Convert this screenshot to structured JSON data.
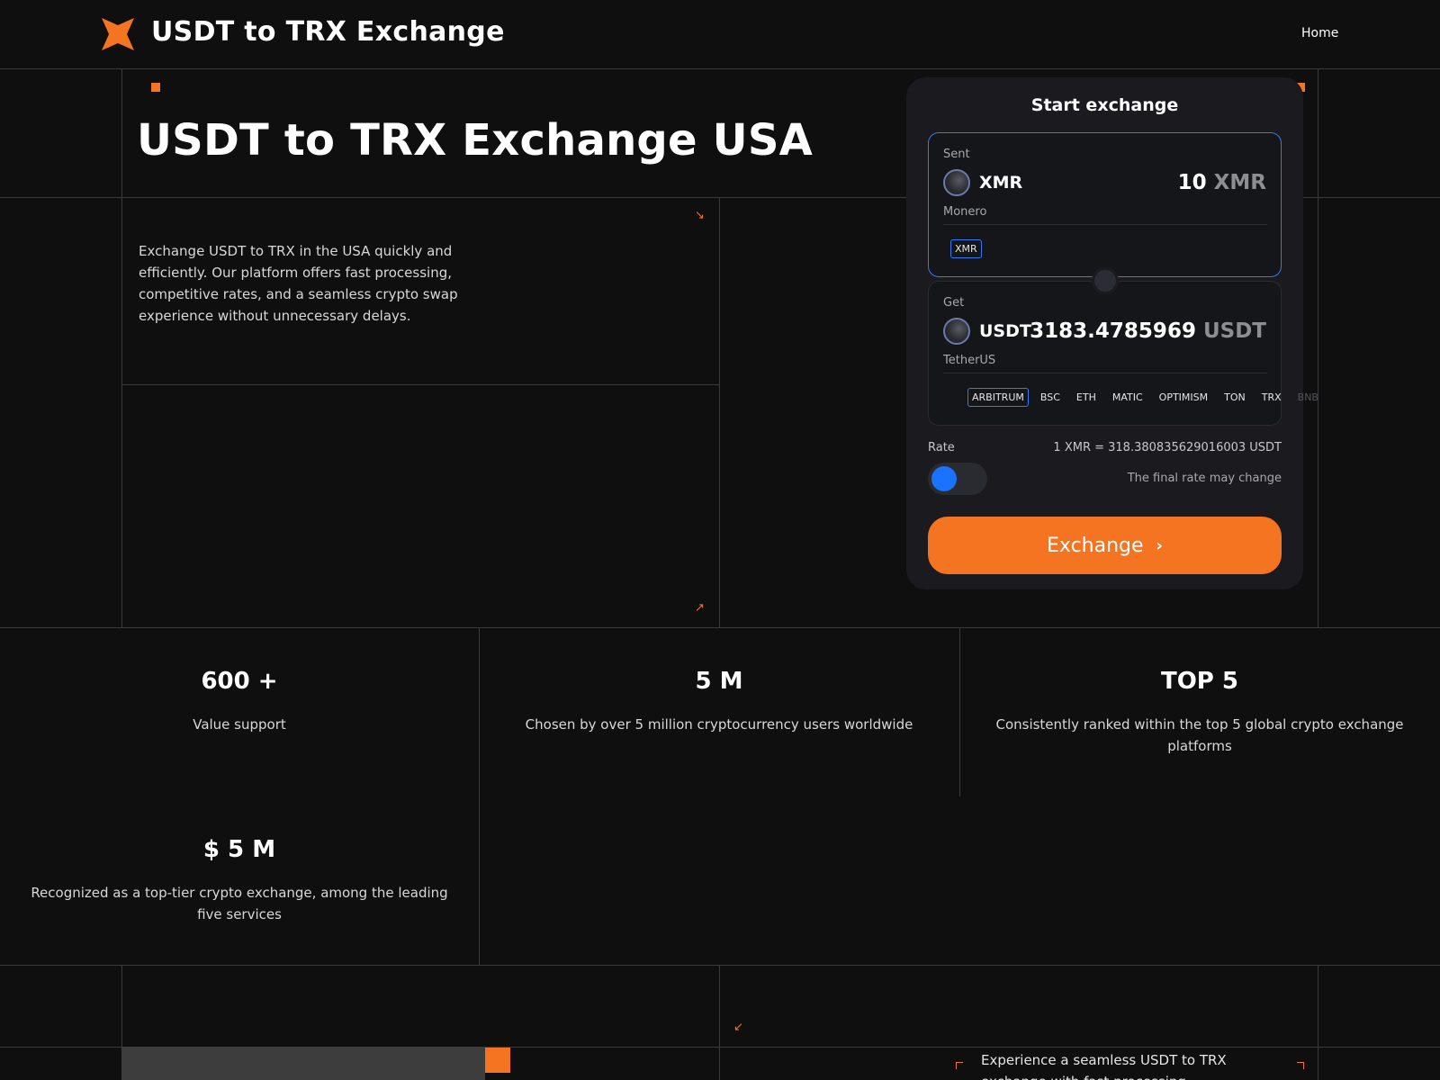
{
  "header": {
    "brand": "USDT to TRX Exchange",
    "nav_home": "Home",
    "accent_color": "#f47421"
  },
  "hero": {
    "title": "USDT to TRX Exchange USA",
    "description": "Exchange USDT to TRX in the USA quickly and efficiently. Our platform offers fast processing, competitive rates, and a seamless crypto swap experience without unnecessary delays."
  },
  "exchange": {
    "title": "Start exchange",
    "sent": {
      "label": "Sent",
      "code": "XMR",
      "name": "Monero",
      "amount": "10",
      "unit": "XMR",
      "networks": [
        "XMR"
      ]
    },
    "get": {
      "label": "Get",
      "code": "USDT",
      "name": "TetherUS",
      "amount": "3183.4785969",
      "unit": "USDT",
      "networks": [
        "ARBITRUM",
        "BSC",
        "ETH",
        "MATIC",
        "OPTIMISM",
        "TON",
        "TRX",
        "BNB"
      ]
    },
    "rate_label": "Rate",
    "rate_value": "1 XMR = 318.380835629016003 USDT",
    "rate_note": "The final rate may change",
    "button_label": "Exchange",
    "button_color": "#f47421",
    "toggle_color": "#1a73ff"
  },
  "stats": [
    {
      "value": "600 +",
      "desc": "Value support"
    },
    {
      "value": "5 M",
      "desc": "Chosen by over 5 million cryptocurrency users worldwide"
    },
    {
      "value": "TOP 5",
      "desc": "Consistently ranked within the top 5 global crypto exchange platforms"
    },
    {
      "value": "$ 5 M",
      "desc": "Recognized as a top-tier crypto exchange, among the leading five services"
    }
  ],
  "bottom": {
    "text": "Experience a seamless USDT to TRX exchange with fast processing"
  }
}
